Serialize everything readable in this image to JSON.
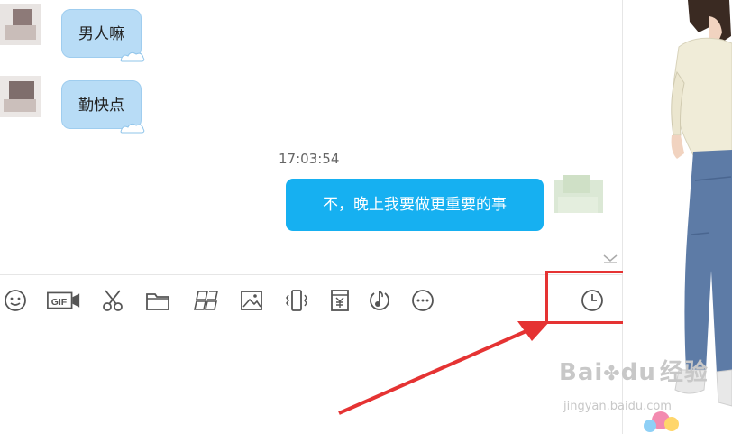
{
  "messages": {
    "incoming": [
      {
        "text": "男人嘛"
      },
      {
        "text": "勤快点"
      }
    ],
    "timestamp": "17:03:54",
    "outgoing": {
      "text": "不，晚上我要做更重要的事"
    }
  },
  "toolbar": {
    "icons": [
      "emoji-icon",
      "gif-icon",
      "scissors-icon",
      "folder-icon",
      "photo-wall-icon",
      "image-icon",
      "shake-icon",
      "red-packet-icon",
      "music-icon",
      "more-icon",
      "clock-icon"
    ],
    "gif_label": "GIF"
  },
  "watermark": {
    "brand": "Bai",
    "brand_paw": "du",
    "product": "经验",
    "url": "jingyan.baidu.com"
  },
  "colors": {
    "bubble_out": "#16b0f1",
    "bubble_in": "#b8dcf6",
    "highlight": "#e53333",
    "icon": "#555555"
  }
}
